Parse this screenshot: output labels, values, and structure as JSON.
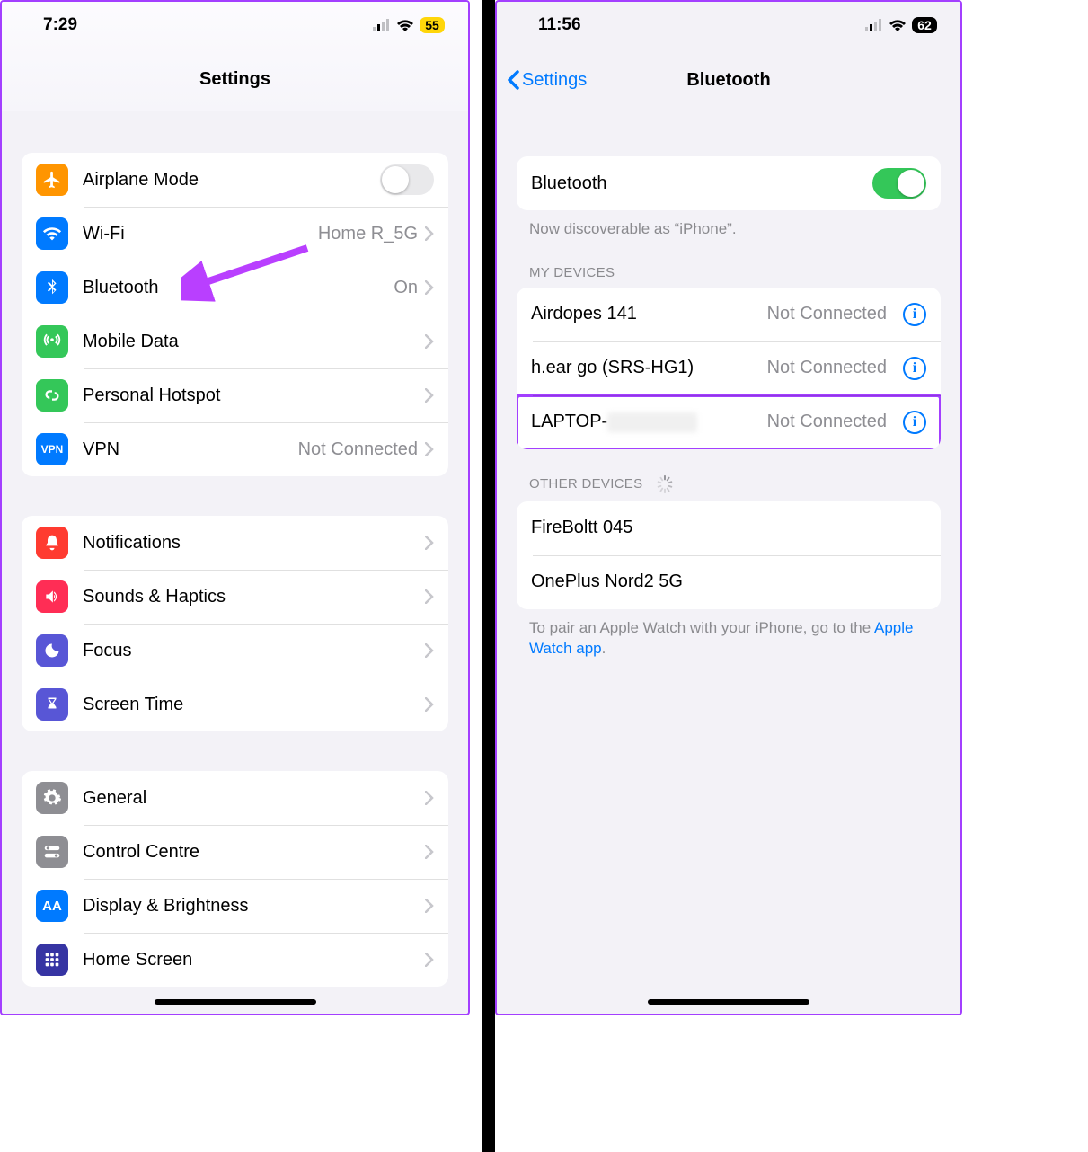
{
  "left": {
    "status": {
      "time": "7:29",
      "battery": "55"
    },
    "title": "Settings",
    "groups": [
      {
        "rows": [
          {
            "idx": 0,
            "label": "Airplane Mode",
            "icon": "airplane",
            "iconColor": "#ff9500",
            "type": "toggle",
            "toggle": "off"
          },
          {
            "idx": 1,
            "label": "Wi-Fi",
            "icon": "wifi",
            "iconColor": "#007aff",
            "type": "link",
            "value": "Home R_5G"
          },
          {
            "idx": 2,
            "label": "Bluetooth",
            "icon": "bluetooth",
            "iconColor": "#007aff",
            "type": "link",
            "value": "On"
          },
          {
            "idx": 3,
            "label": "Mobile Data",
            "icon": "antenna",
            "iconColor": "#34c759",
            "type": "link"
          },
          {
            "idx": 4,
            "label": "Personal Hotspot",
            "icon": "hotspot",
            "iconColor": "#34c759",
            "type": "link"
          },
          {
            "idx": 5,
            "label": "VPN",
            "icon": "vpn",
            "iconColor": "#007aff",
            "type": "link",
            "value": "Not Connected"
          }
        ]
      },
      {
        "rows": [
          {
            "idx": 0,
            "label": "Notifications",
            "icon": "bell",
            "iconColor": "#ff3b30",
            "type": "link"
          },
          {
            "idx": 1,
            "label": "Sounds & Haptics",
            "icon": "speaker",
            "iconColor": "#ff2d55",
            "type": "link"
          },
          {
            "idx": 2,
            "label": "Focus",
            "icon": "moon",
            "iconColor": "#5856d6",
            "type": "link"
          },
          {
            "idx": 3,
            "label": "Screen Time",
            "icon": "hourglass",
            "iconColor": "#5856d6",
            "type": "link"
          }
        ]
      },
      {
        "rows": [
          {
            "idx": 0,
            "label": "General",
            "icon": "gear",
            "iconColor": "#8e8e93",
            "type": "link"
          },
          {
            "idx": 1,
            "label": "Control Centre",
            "icon": "switches",
            "iconColor": "#8e8e93",
            "type": "link"
          },
          {
            "idx": 2,
            "label": "Display & Brightness",
            "icon": "aa",
            "iconColor": "#007aff",
            "type": "link"
          },
          {
            "idx": 3,
            "label": "Home Screen",
            "icon": "grid",
            "iconColor": "#3634a3",
            "type": "link"
          }
        ]
      }
    ]
  },
  "right": {
    "status": {
      "time": "11:56",
      "battery": "62"
    },
    "back": "Settings",
    "title": "Bluetooth",
    "bt_label": "Bluetooth",
    "bt_on": true,
    "discoverable": "Now discoverable as “iPhone”.",
    "section_mydevices": "MY DEVICES",
    "my_devices": [
      {
        "name": "Airdopes 141",
        "status": "Not Connected"
      },
      {
        "name": "h.ear go (SRS-HG1)",
        "status": "Not Connected"
      },
      {
        "name": "LAPTOP-",
        "status": "Not Connected",
        "redacted": true,
        "highlight": true
      }
    ],
    "section_other": "OTHER DEVICES",
    "other_devices": [
      {
        "name": "FireBoltt 045"
      },
      {
        "name": "OnePlus Nord2 5G"
      }
    ],
    "footer_pre": "To pair an Apple Watch with your iPhone, go to the ",
    "footer_link": "Apple Watch app",
    "footer_post": "."
  }
}
